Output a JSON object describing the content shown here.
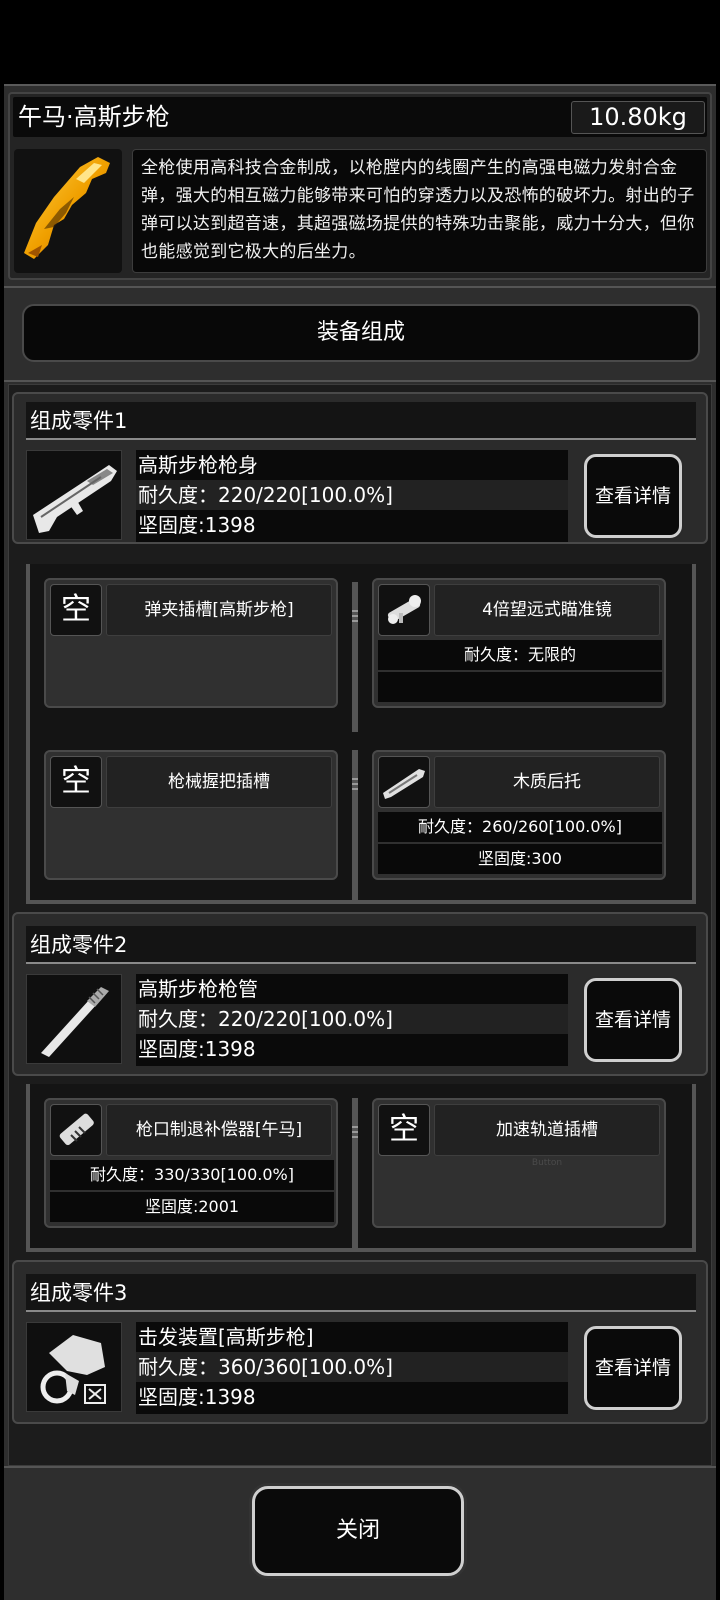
{
  "item": {
    "name": "午马·高斯步枪",
    "weight": "10.80kg",
    "description": "全枪使用高科技合金制成，以枪膛内的线圈产生的高强电磁力发射合金弹，强大的相互磁力能够带来可怕的穿透力以及恐怖的破坏力。射出的子弹可以达到超音速，其超强磁场提供的特殊功击聚能，威力十分大，但你也能感觉到它极大的后坐力。",
    "icon": "gold-rifle-icon"
  },
  "section_button": "装备组成",
  "groups": [
    {
      "header": "组成零件1",
      "part_name": "高斯步枪枪身",
      "durability": "耐久度：220/220[100.0%]",
      "firmness": "坚固度:1398",
      "detail_label": "查看详情",
      "icon": "rifle-body-icon"
    },
    {
      "header": "组成零件2",
      "part_name": "高斯步枪枪管",
      "durability": "耐久度：220/220[100.0%]",
      "firmness": "坚固度:1398",
      "detail_label": "查看详情",
      "icon": "barrel-icon"
    },
    {
      "header": "组成零件3",
      "part_name": "击发装置[高斯步枪]",
      "durability": "耐久度：360/360[100.0%]",
      "firmness": "坚固度:1398",
      "detail_label": "查看详情",
      "icon": "trigger-mechanism-icon"
    }
  ],
  "slots": {
    "g1a": {
      "icon_text": "空",
      "name": "弹夹插槽[高斯步枪]"
    },
    "g1b": {
      "name": "4倍望远式瞄准镜",
      "row1": "耐久度：无限的",
      "row2": "",
      "icon": "scope-icon"
    },
    "g1c": {
      "icon_text": "空",
      "name": "枪械握把插槽"
    },
    "g1d": {
      "name": "木质后托",
      "row1": "耐久度：260/260[100.0%]",
      "row2": "坚固度:300",
      "icon": "stock-icon"
    },
    "g2a": {
      "name": "枪口制退补偿器[午马]",
      "row1": "耐久度：330/330[100.0%]",
      "row2": "坚固度:2001",
      "icon": "muzzle-brake-icon"
    },
    "g2b": {
      "icon_text": "空",
      "name": "加速轨道插槽",
      "faint": "Button"
    }
  },
  "close_label": "关闭",
  "colors": {
    "accent": "#f0a000",
    "panel": "#2e2e2e",
    "border": "#cfcfcf"
  }
}
